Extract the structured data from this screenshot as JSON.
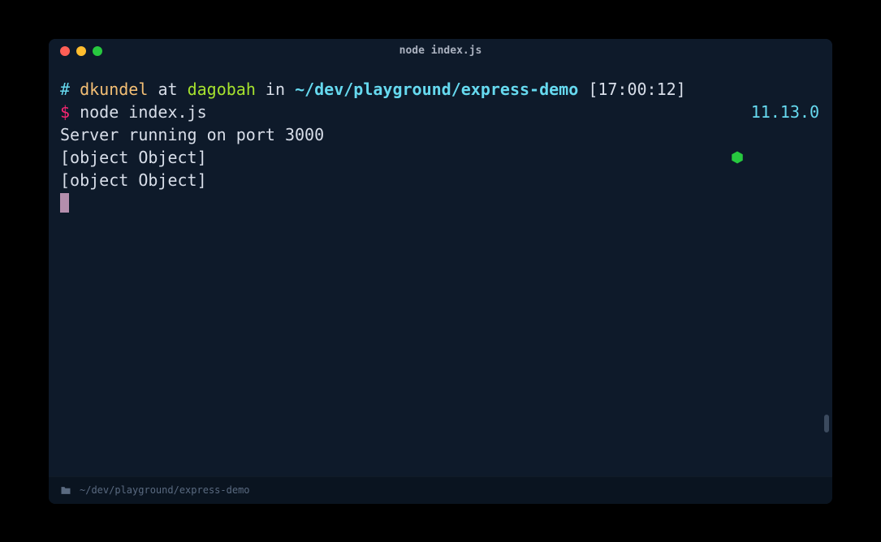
{
  "window": {
    "title": "node index.js"
  },
  "colors": {
    "accent_purple": "#b48ead",
    "hexagon_green": "#27c93f"
  },
  "prompt": {
    "hash": "#",
    "user": "dkundel",
    "at": "at",
    "host": "dagobah",
    "in": "in",
    "path": "~/dev/playground/express-demo",
    "timestamp": "[17:00:12]",
    "symbol": "$",
    "command": "node index.js",
    "node_version": "11.13.0"
  },
  "output": [
    "Server running on port 3000",
    "[object Object]",
    "[object Object]"
  ],
  "statusbar": {
    "path": "~/dev/playground/express-demo"
  }
}
